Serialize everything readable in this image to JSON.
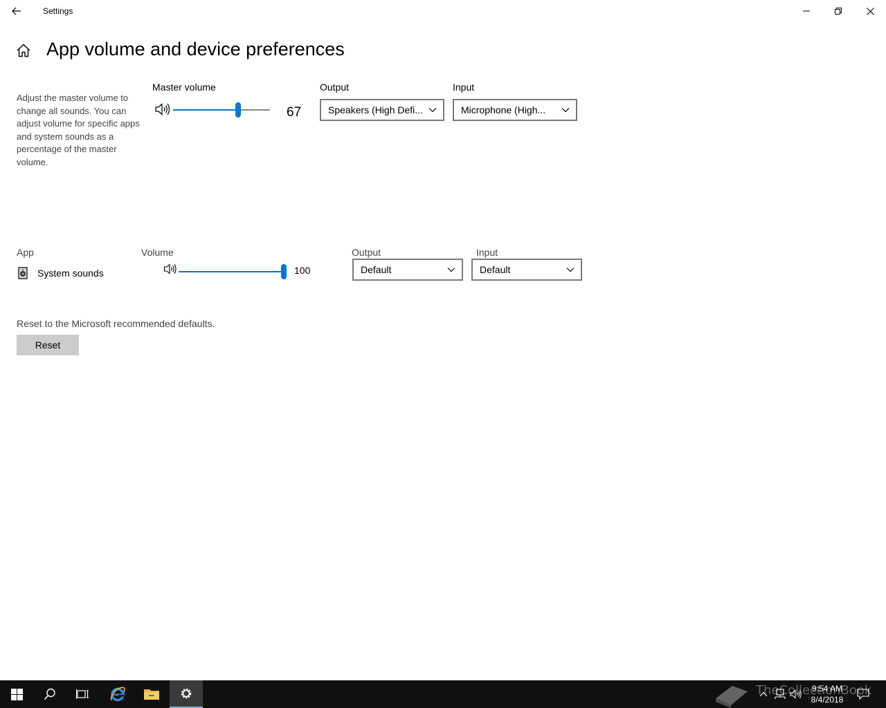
{
  "window": {
    "title": "Settings"
  },
  "header": {
    "title": "App volume and device preferences"
  },
  "master": {
    "description": "Adjust the master volume to change all sounds. You can adjust volume for specific apps and system sounds as a percentage of the master volume.",
    "volume_label": "Master volume",
    "volume_value": "67",
    "volume_level": 0.67,
    "output_label": "Output",
    "output_value": "Speakers (High Defi...",
    "input_label": "Input",
    "input_value": "Microphone (High..."
  },
  "apps": {
    "col_app": "App",
    "col_volume": "Volume",
    "col_output": "Output",
    "col_input": "Input",
    "rows": [
      {
        "name": "System sounds",
        "volume_value": "100",
        "volume_level": 1.0,
        "output_value": "Default",
        "input_value": "Default"
      }
    ]
  },
  "reset": {
    "text": "Reset to the Microsoft recommended defaults.",
    "button_label": "Reset"
  },
  "taskbar": {
    "time": "9:54 AM",
    "date": "8/4/2018",
    "watermark": "TheCollectionBook"
  },
  "colors": {
    "accent": "#0078d7",
    "taskbar": "#101010"
  }
}
